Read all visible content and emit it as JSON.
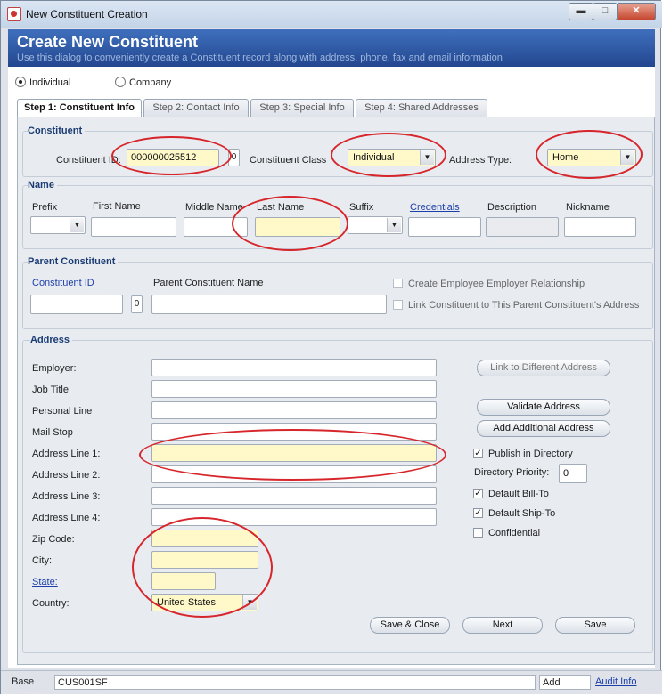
{
  "window": {
    "title": "New Constituent Creation",
    "buttons": {
      "minimize": "▬",
      "maximize": "□",
      "close": "✕"
    }
  },
  "banner": {
    "title": "Create New Constituent",
    "subtitle": "Use this dialog to conveniently create a Constituent record along with address, phone, fax and email information"
  },
  "type_choice": {
    "individual": "Individual",
    "company": "Company",
    "selected": "individual"
  },
  "tabs": [
    {
      "label": "Step 1: Constituent Info",
      "active": true
    },
    {
      "label": "Step 2: Contact Info",
      "active": false
    },
    {
      "label": "Step 3: Special Info",
      "active": false
    },
    {
      "label": "Step 4: Shared Addresses",
      "active": false
    }
  ],
  "constituent": {
    "section_title": "Constituent",
    "id_label": "Constituent ID:",
    "id_value": "000000025512",
    "id_count": "0",
    "class_label": "Constituent Class",
    "class_value": "Individual",
    "address_type_label": "Address Type:",
    "address_type_value": "Home"
  },
  "name": {
    "section_title": "Name",
    "prefix_label": "Prefix",
    "first_label": "First Name",
    "middle_label": "Middle Name",
    "last_label": "Last Name",
    "suffix_label": "Suffix",
    "credentials_label": "Credentials",
    "description_label": "Description",
    "nickname_label": "Nickname"
  },
  "parent": {
    "section_title": "Parent Constituent",
    "id_label": "Constituent ID",
    "count": "0",
    "name_label": "Parent Constituent Name",
    "create_relationship_label": "Create Employee Employer Relationship",
    "link_address_label": "Link Constituent to This Parent Constituent's Address"
  },
  "address": {
    "section_title": "Address",
    "employer_label": "Employer:",
    "job_title_label": "Job Title",
    "personal_line_label": "Personal Line",
    "mail_stop_label": "Mail Stop",
    "line1_label": "Address Line 1:",
    "line2_label": "Address Line 2:",
    "line3_label": "Address Line 3:",
    "line4_label": "Address Line 4:",
    "zip_label": "Zip Code:",
    "city_label": "City:",
    "state_label": "State:",
    "country_label": "Country:",
    "country_value": "United States",
    "link_different_button": "Link to Different Address",
    "validate_button": "Validate Address",
    "add_additional_button": "Add Additional Address",
    "publish_label": "Publish in Directory",
    "publish_checked": true,
    "priority_label": "Directory Priority:",
    "priority_value": "0",
    "bill_to_label": "Default Bill-To",
    "bill_to_checked": true,
    "ship_to_label": "Default Ship-To",
    "ship_to_checked": true,
    "confidential_label": "Confidential",
    "confidential_checked": false
  },
  "actions": {
    "save_close": "Save & Close",
    "next": "Next",
    "save": "Save"
  },
  "statusbar": {
    "base": "Base",
    "screen_code": "CUS001SF",
    "mode": "Add",
    "audit": "Audit Info"
  },
  "colors": {
    "banner": "#2f5aa8",
    "required_field": "#fff8c8",
    "highlight": "#d7262b",
    "group_title": "#1b3c73"
  }
}
